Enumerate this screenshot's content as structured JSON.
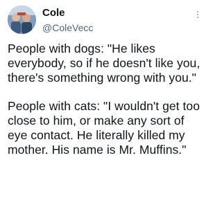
{
  "tweet": {
    "author": {
      "display_name": "Cole",
      "handle": "@ColeVecc"
    },
    "more_icon": "more-vertical-icon",
    "paragraphs": [
      "People with dogs: \"He likes everybody, so if he doesn't like you, there's something wrong with you.\"",
      "People with cats: \"I wouldn't get too close to him, or make any sort of eye contact. He literally killed my mother. His name is Mr. Muffins.\""
    ]
  },
  "colors": {
    "text": "#0f1419",
    "secondary": "#536471",
    "background": "#ffffff"
  }
}
